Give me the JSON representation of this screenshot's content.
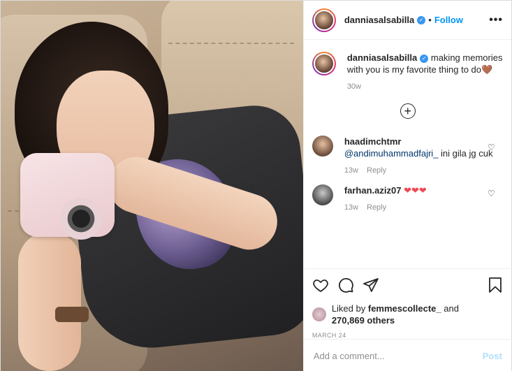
{
  "header": {
    "username": "danniasalsabilla",
    "follow_label": "Follow",
    "dot": "•",
    "more_label": "•••"
  },
  "caption": {
    "username": "danniasalsabilla",
    "text": "making memories with you is my favorite thing to do🤎",
    "time": "30w"
  },
  "comments": [
    {
      "username": "haadimchtmr",
      "mention": "@andimuhammadfajri_",
      "text": " ini gila jg cuk",
      "time": "13w",
      "reply_label": "Reply"
    },
    {
      "username": "farhan.aziz07",
      "text": "❤❤❤",
      "time": "13w",
      "reply_label": "Reply"
    }
  ],
  "likes": {
    "prefix": "Liked by ",
    "user": "femmescollecte_",
    "middle": " and",
    "count": "270,869 others"
  },
  "date": "MARCH 24",
  "add_comment": {
    "placeholder": "Add a comment...",
    "post_label": "Post"
  },
  "icons": {
    "verified": "verified-badge-icon",
    "plus": "load-more-plus-icon",
    "like": "heart-outline-icon",
    "comment": "comment-bubble-icon",
    "share": "paper-plane-icon",
    "save": "bookmark-icon"
  },
  "colors": {
    "accent": "#0095f6",
    "verified": "#3897f0",
    "muted": "#8e8e8e",
    "post_disabled": "#b2dffc",
    "heart_red": "#ed4956"
  }
}
